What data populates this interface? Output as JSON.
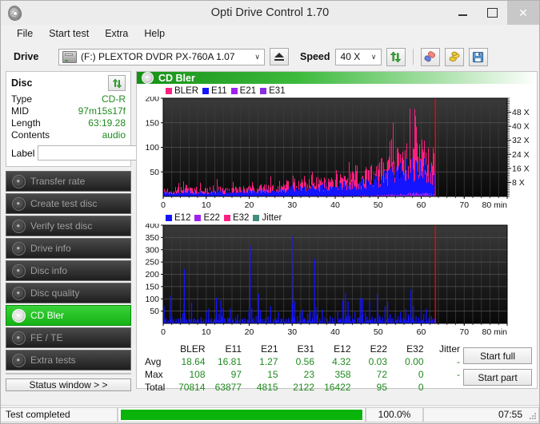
{
  "window": {
    "title": "Opti Drive Control 1.70",
    "icon": "disc-icon",
    "minimize": "–",
    "maximize": "❐",
    "close": "✕"
  },
  "menu": {
    "items": [
      "File",
      "Start test",
      "Extra",
      "Help"
    ]
  },
  "toolbar": {
    "drive_label": "Drive",
    "drive_value": "(F:)  PLEXTOR DVDR  PX-760A 1.07",
    "eject_icon": "eject-icon",
    "speed_label": "Speed",
    "speed_value": "40 X",
    "refresh_icon": "refresh-arrows-icon",
    "erase_icon": "eraser-icon",
    "bookmark_icon": "gold-coins-icon",
    "save_icon": "floppy-save-icon",
    "caret": "∨"
  },
  "disc": {
    "title": "Disc",
    "refresh_icon": "refresh-arrows-icon",
    "rows": [
      {
        "key": "Type",
        "value": "CD-R"
      },
      {
        "key": "MID",
        "value": "97m15s17f"
      },
      {
        "key": "Length",
        "value": "63:19.28"
      },
      {
        "key": "Contents",
        "value": "audio"
      }
    ],
    "label_key": "Label",
    "label_value": "",
    "label_placeholder": "",
    "disc_button_icon": "cd-disc-icon"
  },
  "sidebar": {
    "items": [
      {
        "label": "Transfer rate",
        "icon": "disc-icon",
        "active": false
      },
      {
        "label": "Create test disc",
        "icon": "disc-icon",
        "active": false
      },
      {
        "label": "Verify test disc",
        "icon": "disc-icon",
        "active": false
      },
      {
        "label": "Drive info",
        "icon": "disc-icon",
        "active": false
      },
      {
        "label": "Disc info",
        "icon": "disc-icon",
        "active": false
      },
      {
        "label": "Disc quality",
        "icon": "disc-icon",
        "active": false
      },
      {
        "label": "CD Bler",
        "icon": "disc-icon",
        "active": true
      },
      {
        "label": "FE / TE",
        "icon": "disc-icon",
        "active": false
      },
      {
        "label": "Extra tests",
        "icon": "disc-icon",
        "active": false
      }
    ],
    "status_window_label": "Status window > >"
  },
  "panel": {
    "title": "CD Bler",
    "icon": "disc-icon",
    "start_full": "Start full",
    "start_part": "Start part"
  },
  "colors": {
    "bler": "#ff2080",
    "e11": "#1414ff",
    "e21": "#a020f0",
    "e31": "#8a2be2",
    "e12": "#1414ff",
    "e22": "#a020f0",
    "e32": "#ff2080",
    "jitter": "#3f8f7f",
    "marker": "#ff0000",
    "accent_green": "#15b215",
    "value_green": "#1f8a1f"
  },
  "chart_data": [
    {
      "type": "area",
      "name": "bler-chart",
      "title": "",
      "legend": [
        {
          "label": "BLER",
          "color": "#ff2080"
        },
        {
          "label": "E11",
          "color": "#1414ff"
        },
        {
          "label": "E21",
          "color": "#a020f0"
        },
        {
          "label": "E31",
          "color": "#8a2be2"
        }
      ],
      "legend_position": "top-left",
      "xlabel": "min",
      "ylabel": "",
      "xlim": [
        0,
        80
      ],
      "ylim": [
        0,
        200
      ],
      "xticks": [
        0,
        10,
        20,
        30,
        40,
        50,
        60,
        70,
        80
      ],
      "xtick_labels": [
        "0",
        "10",
        "20",
        "30",
        "40",
        "50",
        "60",
        "70",
        "80 min"
      ],
      "yticks": [
        50,
        100,
        150,
        200
      ],
      "ytick_labels": [
        "50",
        "100",
        "150",
        "200"
      ],
      "right_axis_label": "X",
      "right_ticks": [
        8,
        16,
        24,
        32,
        40,
        48
      ],
      "right_tick_labels": [
        "8 X",
        "16 X",
        "24 X",
        "32 X",
        "40 X",
        "48 X"
      ],
      "right_ylim": [
        0,
        56
      ],
      "data_end_min": 63.3,
      "marker_min": 63.3,
      "grid": true,
      "series": [
        {
          "name": "BLER",
          "color": "#ff2080",
          "x": [
            0,
            1,
            2,
            3,
            4,
            5,
            6,
            7,
            8,
            9,
            10,
            11,
            12,
            13,
            14,
            15,
            16,
            17,
            18,
            19,
            20,
            21,
            22,
            23,
            24,
            25,
            26,
            27,
            28,
            29,
            30,
            31,
            32,
            33,
            34,
            35,
            36,
            37,
            38,
            39,
            40,
            41,
            42,
            43,
            44,
            45,
            46,
            47,
            48,
            49,
            50,
            51,
            52,
            53,
            54,
            55,
            56,
            57,
            58,
            59,
            60,
            61,
            62,
            63
          ],
          "values": [
            12,
            13,
            11,
            14,
            12,
            26,
            13,
            12,
            14,
            13,
            12,
            14,
            16,
            15,
            13,
            14,
            16,
            15,
            14,
            16,
            15,
            17,
            16,
            18,
            17,
            19,
            20,
            22,
            21,
            24,
            30,
            23,
            25,
            24,
            26,
            25,
            28,
            27,
            30,
            29,
            31,
            33,
            32,
            35,
            34,
            37,
            36,
            40,
            42,
            45,
            50,
            55,
            58,
            62,
            72,
            66,
            70,
            80,
            85,
            82,
            78,
            75,
            70,
            65
          ]
        },
        {
          "name": "E11",
          "color": "#1414ff",
          "x": [
            0,
            1,
            2,
            3,
            4,
            5,
            6,
            7,
            8,
            9,
            10,
            11,
            12,
            13,
            14,
            15,
            16,
            17,
            18,
            19,
            20,
            21,
            22,
            23,
            24,
            25,
            26,
            27,
            28,
            29,
            30,
            31,
            32,
            33,
            34,
            35,
            36,
            37,
            38,
            39,
            40,
            41,
            42,
            43,
            44,
            45,
            46,
            47,
            48,
            49,
            50,
            51,
            52,
            53,
            54,
            55,
            56,
            57,
            58,
            59,
            60,
            61,
            62,
            63
          ],
          "values": [
            8,
            9,
            8,
            10,
            9,
            14,
            9,
            8,
            10,
            9,
            9,
            10,
            11,
            11,
            9,
            10,
            11,
            11,
            10,
            12,
            11,
            12,
            12,
            13,
            12,
            14,
            15,
            16,
            15,
            17,
            20,
            17,
            18,
            17,
            19,
            18,
            20,
            19,
            22,
            21,
            23,
            24,
            23,
            26,
            25,
            27,
            27,
            30,
            32,
            34,
            38,
            42,
            44,
            47,
            53,
            50,
            53,
            62,
            64,
            61,
            58,
            56,
            52,
            48
          ]
        },
        {
          "name": "E21",
          "color": "#a020f0",
          "x": [
            0,
            10,
            20,
            30,
            40,
            45,
            50,
            52,
            54,
            56,
            58,
            60,
            62,
            63
          ],
          "values": [
            0.3,
            0.4,
            0.5,
            0.7,
            0.9,
            1.1,
            1.8,
            2.2,
            2.8,
            3.4,
            4.0,
            4.4,
            4.0,
            3.2
          ]
        },
        {
          "name": "E31",
          "color": "#8a2be2",
          "x": [
            0,
            10,
            20,
            30,
            40,
            50,
            55,
            60,
            63
          ],
          "values": [
            0.1,
            0.2,
            0.3,
            0.4,
            0.5,
            0.8,
            1.1,
            1.4,
            1.2
          ]
        }
      ]
    },
    {
      "type": "bar",
      "name": "e12-chart",
      "title": "",
      "legend": [
        {
          "label": "E12",
          "color": "#1414ff"
        },
        {
          "label": "E22",
          "color": "#a020f0"
        },
        {
          "label": "E32",
          "color": "#ff2080"
        },
        {
          "label": "Jitter",
          "color": "#3f8f7f"
        }
      ],
      "legend_position": "top-left",
      "xlabel": "min",
      "ylabel": "",
      "xlim": [
        0,
        80
      ],
      "ylim": [
        0,
        400
      ],
      "xticks": [
        0,
        10,
        20,
        30,
        40,
        50,
        60,
        70,
        80
      ],
      "xtick_labels": [
        "0",
        "10",
        "20",
        "30",
        "40",
        "50",
        "60",
        "70",
        "80 min"
      ],
      "yticks": [
        50,
        100,
        150,
        200,
        250,
        300,
        350,
        400
      ],
      "ytick_labels": [
        "50",
        "100",
        "150",
        "200",
        "250",
        "300",
        "350",
        "400"
      ],
      "data_end_min": 63.3,
      "marker_min": 63.3,
      "grid": true,
      "series": [
        {
          "name": "E12",
          "color": "#1414ff",
          "x": [
            0.2,
            0.6,
            1.1,
            1.6,
            2.0,
            2.4,
            3.0,
            3.6,
            4.2,
            4.9,
            5.4,
            6.0,
            6.6,
            7.2,
            7.6,
            8.2,
            8.8,
            9.4,
            10.0,
            10.6,
            11.2,
            11.8,
            12.4,
            13.0,
            13.4,
            13.9,
            14.4,
            15.0,
            15.6,
            16.2,
            16.8,
            17.3,
            17.8,
            18.4,
            19.0,
            19.6,
            20.2,
            20.6,
            21.0,
            21.6,
            22.2,
            22.6,
            23.2,
            23.8,
            24.4,
            25.0,
            25.6,
            26.2,
            26.8,
            27.4,
            28.0,
            28.6,
            29.2,
            29.8,
            30.2,
            30.6,
            31.2,
            31.8,
            32.4,
            33.0,
            33.6,
            34.2,
            34.8,
            35.2,
            35.8,
            36.4,
            37.0,
            37.6,
            38.2,
            38.8,
            39.4,
            40.0,
            40.6,
            41.2,
            41.8,
            42.4,
            43.0,
            43.4,
            44.0,
            44.6,
            45.2,
            45.8,
            46.4,
            47.0,
            47.4,
            48.0,
            48.6,
            49.2,
            49.8,
            50.4,
            51.0,
            51.6,
            52.2,
            52.8,
            53.4,
            54.0,
            54.6,
            55.2,
            55.8,
            56.4,
            57.0,
            57.6,
            58.2,
            58.8,
            59.4,
            60.0,
            60.6,
            61.2,
            61.8,
            62.4,
            63.0
          ],
          "values": [
            70,
            14,
            12,
            113,
            30,
            16,
            18,
            20,
            22,
            221,
            18,
            14,
            86,
            20,
            12,
            16,
            26,
            18,
            50,
            60,
            22,
            18,
            105,
            40,
            95,
            62,
            18,
            24,
            60,
            16,
            24,
            36,
            14,
            18,
            22,
            16,
            315,
            60,
            22,
            30,
            120,
            55,
            18,
            22,
            28,
            70,
            18,
            22,
            45,
            20,
            26,
            18,
            22,
            16,
            355,
            92,
            30,
            44,
            56,
            22,
            40,
            48,
            24,
            263,
            36,
            20,
            56,
            24,
            18,
            30,
            22,
            26,
            50,
            18,
            95,
            125,
            88,
            30,
            20,
            48,
            22,
            103,
            100,
            44,
            28,
            90,
            26,
            20,
            120,
            30,
            24,
            70,
            88,
            36,
            22,
            40,
            30,
            46,
            22,
            60,
            36,
            138,
            72,
            30,
            24,
            55,
            38,
            60,
            24,
            30,
            20
          ]
        },
        {
          "name": "E22",
          "color": "#a020f0",
          "x": [],
          "values": []
        },
        {
          "name": "E32",
          "color": "#ff2080",
          "x": [],
          "values": []
        },
        {
          "name": "Jitter",
          "color": "#3f8f7f",
          "x": [],
          "values": []
        }
      ]
    }
  ],
  "stats": {
    "columns": [
      "BLER",
      "E11",
      "E21",
      "E31",
      "E12",
      "E22",
      "E32",
      "Jitter"
    ],
    "rows": [
      {
        "label": "Avg",
        "values": [
          "18.64",
          "16.81",
          "1.27",
          "0.56",
          "4.32",
          "0.03",
          "0.00",
          "-"
        ]
      },
      {
        "label": "Max",
        "values": [
          "108",
          "97",
          "15",
          "23",
          "358",
          "72",
          "0",
          "-"
        ]
      },
      {
        "label": "Total",
        "values": [
          "70814",
          "63877",
          "4815",
          "2122",
          "16422",
          "95",
          "0",
          ""
        ]
      }
    ]
  },
  "statusbar": {
    "status": "Test completed",
    "progress_percent": 100.0,
    "progress_text": "100.0%",
    "elapsed": "07:55"
  }
}
